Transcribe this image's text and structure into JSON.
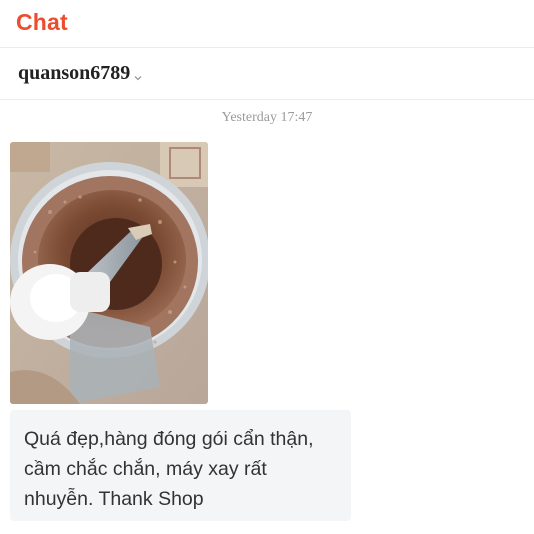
{
  "header": {
    "title": "Chat"
  },
  "conversation": {
    "username": "quanson6789",
    "dropdown_icon": "chevron-down-icon"
  },
  "messages": [
    {
      "timestamp": "Yesterday 17:47",
      "type": "image",
      "image_description_icon": "food-processor-photo"
    },
    {
      "type": "text",
      "text": "Quá đẹp,hàng đóng gói cẩn thận,\ncầm chắc chắn,  máy xay rất\nnhuyễn. Thank Shop"
    }
  ],
  "colors": {
    "brand": "#ee4d2d",
    "bubble_bg": "#f4f5f7",
    "timestamp": "#9b9b9b"
  }
}
